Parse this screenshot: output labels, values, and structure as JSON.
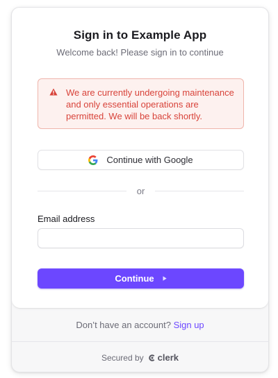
{
  "header": {
    "title": "Sign in to Example App",
    "subtitle": "Welcome back! Please sign in to continue"
  },
  "alert": {
    "icon": "warning-triangle-icon",
    "message": "We are currently undergoing maintenance and only essential operations are permitted. We will be back shortly.",
    "color": "#d8433a"
  },
  "social": {
    "google_label": "Continue with Google",
    "icon": "google-icon"
  },
  "divider": {
    "text": "or"
  },
  "form": {
    "email_label": "Email address",
    "email_value": "",
    "continue_label": "Continue",
    "continue_icon": "play-icon",
    "accent": "#6c47ff"
  },
  "footer": {
    "prompt": "Don’t have an account?",
    "signup_link": "Sign up",
    "secured_by": "Secured by",
    "brand": "clerk"
  }
}
